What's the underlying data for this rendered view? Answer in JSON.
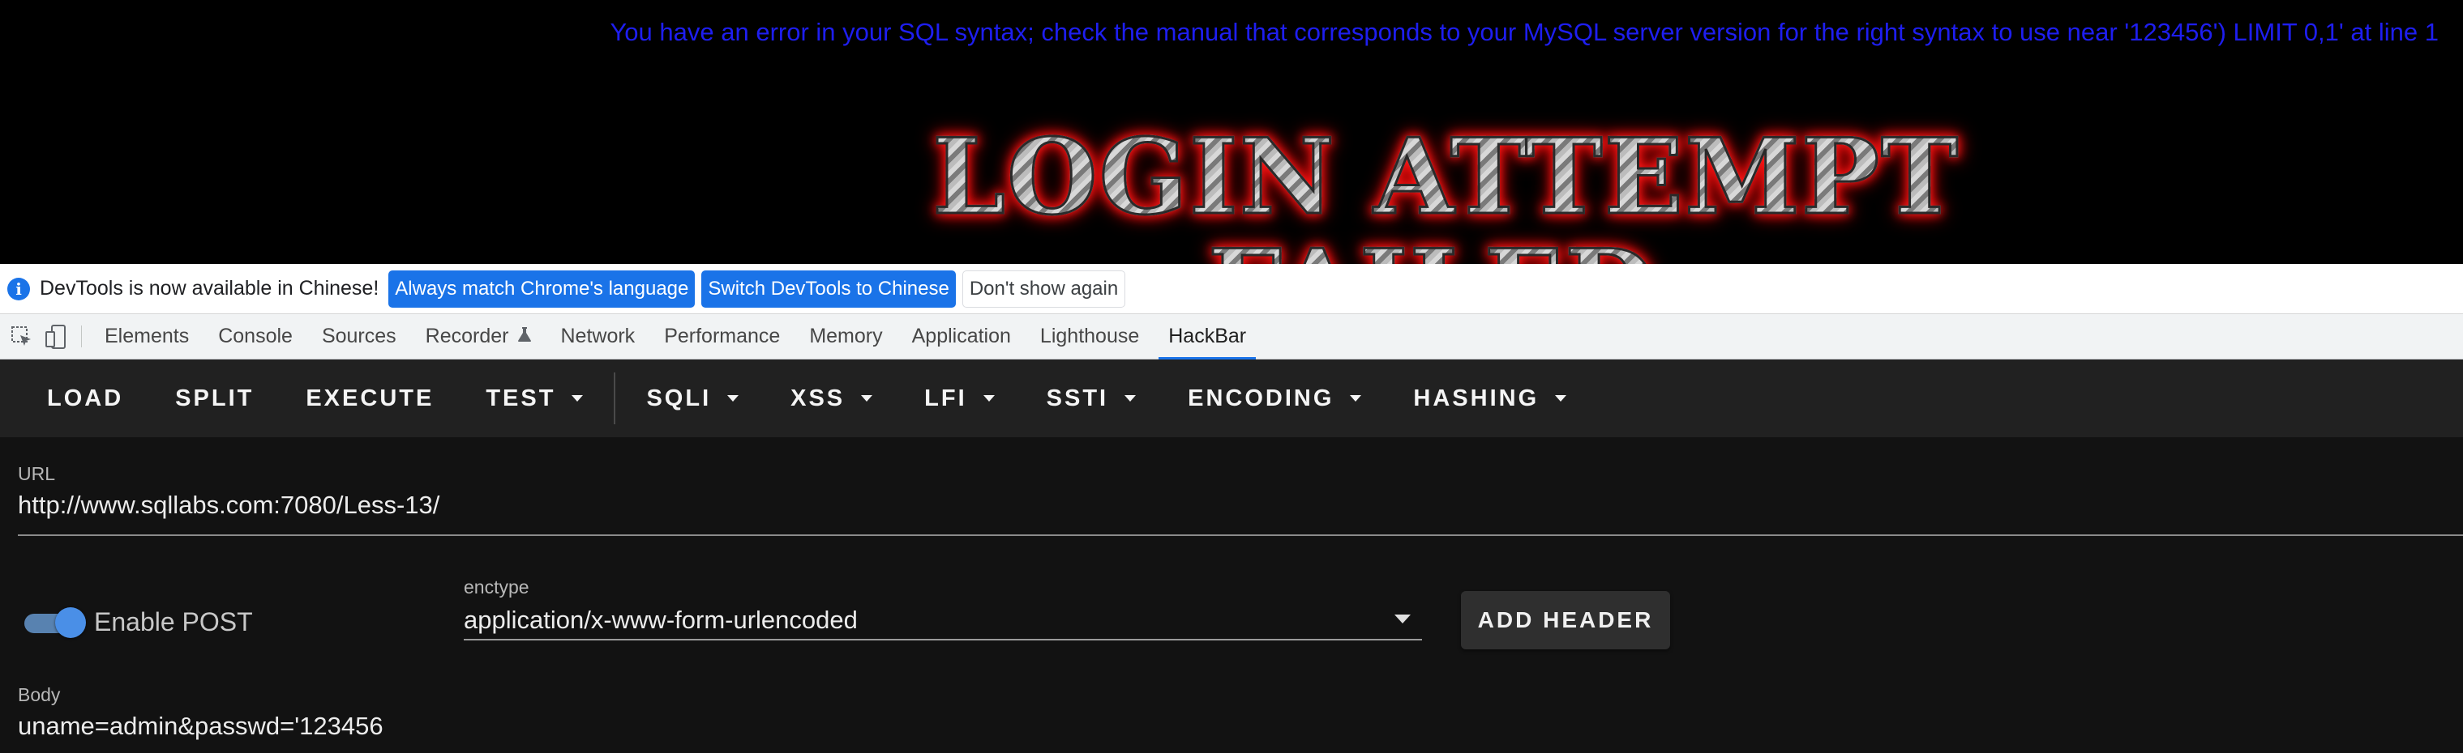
{
  "webpage": {
    "sql_error": "You have an error in your SQL syntax; check the manual that corresponds to your MySQL server version for the right syntax to use near '123456') LIMIT 0,1' at line 1",
    "banner_line1": "LOGIN ATTEMPT",
    "banner_line2": "FAILED"
  },
  "infobar": {
    "icon": "info-icon",
    "message": "DevTools is now available in Chinese!",
    "btn_match": "Always match Chrome's language",
    "btn_switch": "Switch DevTools to Chinese",
    "btn_dismiss": "Don't show again"
  },
  "devtools_tabs": {
    "items": [
      "Elements",
      "Console",
      "Sources",
      "Recorder",
      "Network",
      "Performance",
      "Memory",
      "Application",
      "Lighthouse",
      "HackBar"
    ],
    "active": "HackBar"
  },
  "hackbar": {
    "toolbar": {
      "load": "LOAD",
      "split": "SPLIT",
      "execute": "EXECUTE",
      "test": "TEST",
      "sqli": "SQLI",
      "xss": "XSS",
      "lfi": "LFI",
      "ssti": "SSTI",
      "encoding": "ENCODING",
      "hashing": "HASHING"
    },
    "url_label": "URL",
    "url_value": "http://www.sqllabs.com:7080/Less-13/",
    "enable_post_label": "Enable POST",
    "enable_post_on": true,
    "enctype_label": "enctype",
    "enctype_value": "application/x-www-form-urlencoded",
    "add_header": "ADD HEADER",
    "body_label": "Body",
    "body_value": "uname=admin&passwd='123456"
  },
  "colors": {
    "accent": "#1a73e8",
    "sql_error_text": "#1e1ef0",
    "banner_glow": "#ff1a1a",
    "hackbar_bg": "#121212"
  }
}
